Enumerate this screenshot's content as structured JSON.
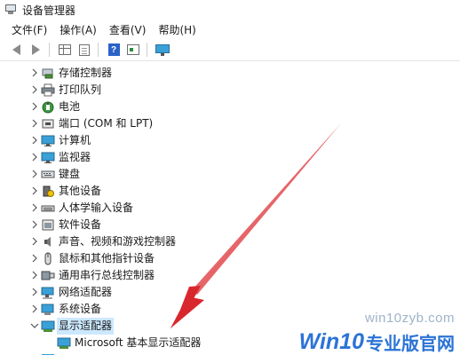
{
  "window": {
    "title": "设备管理器"
  },
  "menu": [
    "文件(F)",
    "操作(A)",
    "查看(V)",
    "帮助(H)"
  ],
  "toolbar": {
    "buttons": [
      "back-icon",
      "forward-icon",
      "grid-icon",
      "document-icon",
      "help-icon",
      "properties-icon",
      "monitor-icon"
    ]
  },
  "tree": {
    "items": [
      {
        "label": "存储控制器",
        "icon": "storage-controller-icon",
        "expanded": false
      },
      {
        "label": "打印队列",
        "icon": "printer-icon",
        "expanded": false
      },
      {
        "label": "电池",
        "icon": "battery-icon",
        "expanded": false
      },
      {
        "label": "端口 (COM 和 LPT)",
        "icon": "port-icon",
        "expanded": false
      },
      {
        "label": "计算机",
        "icon": "computer-icon",
        "expanded": false
      },
      {
        "label": "监视器",
        "icon": "monitor-icon",
        "expanded": false
      },
      {
        "label": "键盘",
        "icon": "keyboard-icon",
        "expanded": false
      },
      {
        "label": "其他设备",
        "icon": "other-devices-icon",
        "expanded": false
      },
      {
        "label": "人体学输入设备",
        "icon": "hid-icon",
        "expanded": false
      },
      {
        "label": "软件设备",
        "icon": "software-device-icon",
        "expanded": false
      },
      {
        "label": "声音、视频和游戏控制器",
        "icon": "sound-icon",
        "expanded": false
      },
      {
        "label": "鼠标和其他指针设备",
        "icon": "mouse-icon",
        "expanded": false
      },
      {
        "label": "通用串行总线控制器",
        "icon": "usb-icon",
        "expanded": false
      },
      {
        "label": "网络适配器",
        "icon": "network-adapter-icon",
        "expanded": false
      },
      {
        "label": "系统设备",
        "icon": "system-device-icon",
        "expanded": false
      },
      {
        "label": "显示适配器",
        "icon": "display-adapter-icon",
        "expanded": true,
        "selected": true
      }
    ],
    "child": {
      "label": "Microsoft 基本显示适配器",
      "icon": "display-adapter-icon"
    }
  },
  "watermark": {
    "site": "win10zyb.com",
    "brand_main": "Win10",
    "brand_sub": "专业版官网"
  },
  "colors": {
    "selection": "#cce8ff",
    "arrow": "#d9272e",
    "brand": "#2b73d6"
  }
}
